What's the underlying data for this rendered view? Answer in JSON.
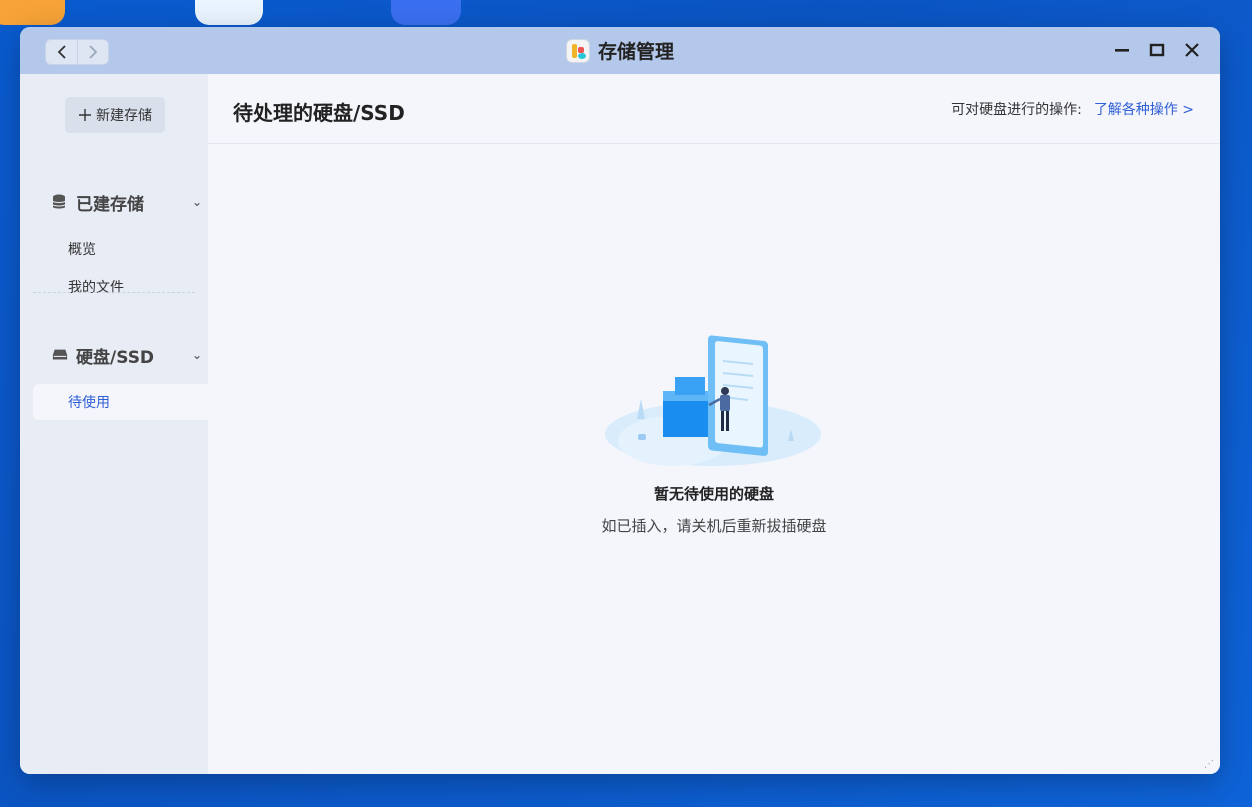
{
  "window": {
    "title": "存储管理",
    "nav": {
      "back": "‹",
      "forward": "›"
    },
    "controls": {
      "minimize": "—",
      "maximize": "□",
      "close": "✕"
    }
  },
  "sidebar": {
    "new_button": {
      "icon": "plus-icon",
      "label": "新建存储"
    },
    "sections": [
      {
        "icon": "database-icon",
        "label": "已建存储",
        "items": [
          {
            "label": "概览"
          },
          {
            "label": "我的文件"
          }
        ]
      },
      {
        "icon": "drive-icon",
        "label": "硬盘/SSD",
        "items": [
          {
            "label": "待使用",
            "active": true
          }
        ]
      }
    ]
  },
  "main": {
    "title": "待处理的硬盘/SSD",
    "ops_text": "可对硬盘进行的操作:",
    "ops_link": "了解各种操作 >",
    "empty_state": {
      "title": "暂无待使用的硬盘",
      "subtitle": "如已插入，请关机后重新拔插硬盘",
      "illustration": "empty-disk-illustration"
    }
  },
  "colors": {
    "accent": "#2f5fd6",
    "titlebar": "#b3c8ea",
    "sidebar": "#e7ecf5",
    "desktop": "#0b55c3"
  }
}
